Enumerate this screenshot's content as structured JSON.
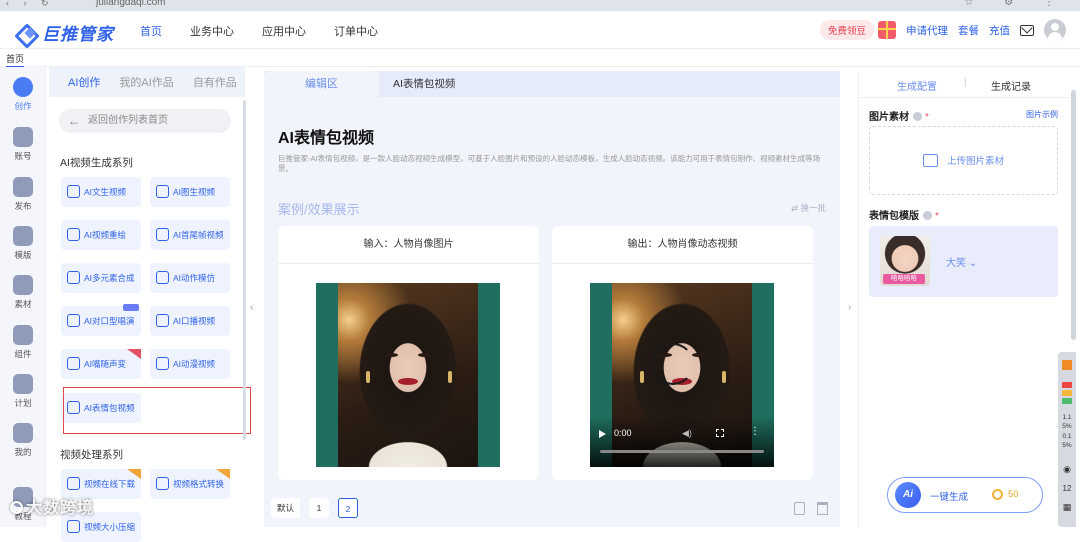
{
  "browser": {
    "url": "juliangdaqi.com"
  },
  "brand": {
    "name": "巨推管家",
    "accent": "#2f62e8"
  },
  "nav": {
    "items": [
      "首页",
      "业务中心",
      "应用中心",
      "订单中心"
    ],
    "active": "首页"
  },
  "topright": {
    "promo": "免费领豆",
    "agent": "申请代理",
    "plans": "套餐",
    "recharge": "充值"
  },
  "page_tab": "首页",
  "rail": [
    {
      "label": "创作",
      "icon": "create-icon"
    },
    {
      "label": "账号",
      "icon": "account-icon"
    },
    {
      "label": "发布",
      "icon": "publish-icon"
    },
    {
      "label": "模版",
      "icon": "template-icon"
    },
    {
      "label": "素材",
      "icon": "material-icon"
    },
    {
      "label": "组件",
      "icon": "component-icon"
    },
    {
      "label": "计划",
      "icon": "plan-icon"
    },
    {
      "label": "我的",
      "icon": "profile-icon"
    },
    {
      "label": "教程",
      "icon": "tutorial-icon"
    }
  ],
  "left_panel": {
    "tabs": [
      "AI创作",
      "我的AI作品",
      "自有作品"
    ],
    "back": "返回创作列表首页",
    "section1": "AI视频生成系列",
    "cards": [
      "AI文生视频",
      "AI图生视频",
      "AI视频重绘",
      "AI首尾帧视频",
      "AI多元素合成",
      "AI动作模仿",
      "AI对口型唱演",
      "AI口播视频",
      "AI嘴随声变",
      "AI动漫视频",
      "AI表情包视频"
    ],
    "section2": "视频处理系列",
    "cards2": [
      "视频在线下载",
      "视频格式转换",
      "视频大小压缩"
    ]
  },
  "center": {
    "tabs": [
      "编辑区",
      "AI表情包视频"
    ],
    "title": "AI表情包视频",
    "desc": "巨推管家-AI表情包视频，是一款人脸动态视频生成模型，可基于人脸图片和预设的人脸动态模板，生成人脸动态视频。该能力可用于表情包制作、视频素材生成等场景。",
    "case_title": "案例/效果展示",
    "swap": "换一批",
    "input_label": "输入：人物肖像图片",
    "output_label": "输出：人物肖像动态视频",
    "video_time": "0:00",
    "pager": [
      "默认",
      "1",
      "2"
    ],
    "pager_current": "2"
  },
  "right_panel": {
    "tabs": [
      "生成配置",
      "生成记录"
    ],
    "image_label": "图片素材",
    "image_example": "图片示例",
    "upload": "上传图片素材",
    "template_label": "表情包模版",
    "template_tag": "哈哈哈哈",
    "template_name": "大笑",
    "generate": "一键生成",
    "points": "50"
  },
  "extension": {
    "items": [
      "1.1",
      "5%",
      "0.1",
      "5%",
      "12"
    ]
  },
  "watermark": "大数跨境"
}
